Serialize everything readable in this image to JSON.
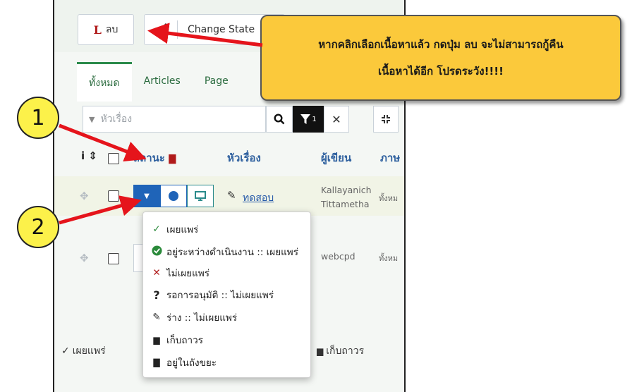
{
  "toolbar": {
    "delete_letter": "L",
    "delete_label": "ลบ",
    "change_state_label": "Change State"
  },
  "tabs": [
    {
      "label": "ทั้งหมด",
      "active": true
    },
    {
      "label": "Articles",
      "active": false
    },
    {
      "label": "Page",
      "active": false
    }
  ],
  "search": {
    "placeholder": "หัวเรื่อง",
    "filter_count": "1"
  },
  "table": {
    "headers": {
      "status": "สถานะ",
      "title": "หัวเรื่อง",
      "author": "ผู้เขียน",
      "language": "ภาษ"
    },
    "rows": [
      {
        "title": "ทดสอบ",
        "author_line1": "Kallayanich",
        "author_line2": "Tittametha",
        "language": "ทั้งหม"
      },
      {
        "title": "",
        "author_line1": "webcpd",
        "author_line2": "",
        "language": "ทั้งหม"
      }
    ]
  },
  "dropdown": {
    "items": [
      {
        "icon": "check-icon",
        "label": "เผยแพร่"
      },
      {
        "icon": "check-circle-icon",
        "label": "อยู่ระหว่างดำเนินงาน :: เผยแพร่"
      },
      {
        "icon": "x-icon",
        "label": "ไม่เผยแพร่"
      },
      {
        "icon": "question-icon",
        "label": "รอการอนุมัติ :: ไม่เผยแพร่"
      },
      {
        "icon": "pencil-icon",
        "label": "ร่าง :: ไม่เผยแพร่"
      },
      {
        "icon": "archive-icon",
        "label": "เก็บถาวร"
      },
      {
        "icon": "trash-icon",
        "label": "อยู่ในถังขยะ"
      }
    ]
  },
  "footer": {
    "publish_label": "เผยแพร่",
    "archive_label": "เก็บถาวร"
  },
  "annotation": {
    "note_line1": "หากคลิกเลือกเนื้อหาแล้ว กดปุ่ม ลบ จะไม่สามารถกู้คืน",
    "note_line2": "เนื้อหาได้อีก โปรดระวัง!!!!",
    "marker1": "1",
    "marker2": "2"
  },
  "colors": {
    "note_bg": "#fbc93b",
    "marker_bg": "#fcf14a",
    "arrow": "#e5141b",
    "link": "#2458a8",
    "primary": "#1f64b8"
  }
}
